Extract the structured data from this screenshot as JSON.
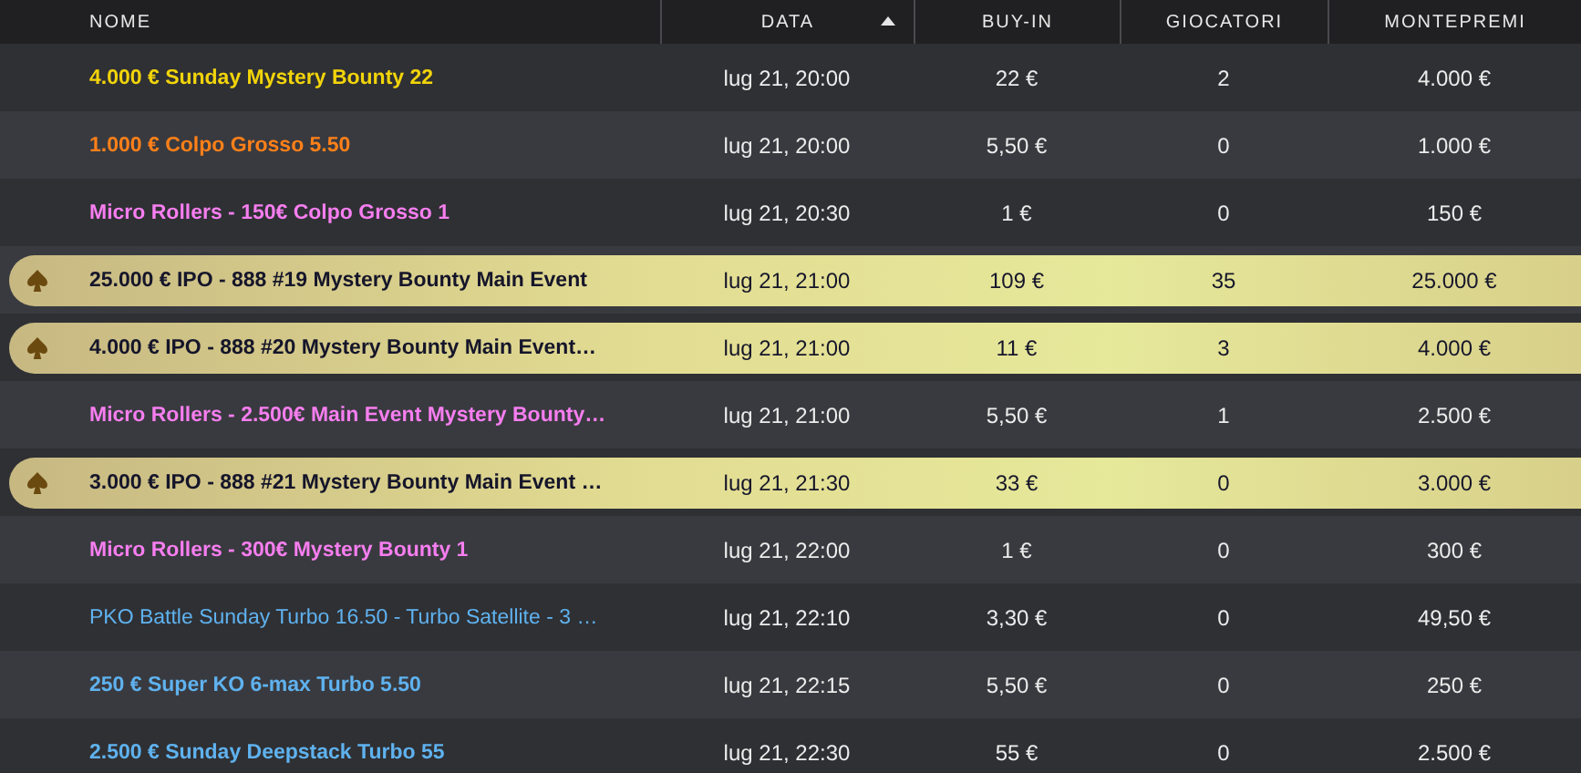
{
  "table": {
    "columns": [
      {
        "label": "NOME",
        "sorted": false
      },
      {
        "label": "DATA",
        "sorted": true
      },
      {
        "label": "BUY-IN",
        "sorted": false
      },
      {
        "label": "GIOCATORI",
        "sorted": false
      },
      {
        "label": "MONTEPREMI",
        "sorted": false
      }
    ],
    "rows": [
      {
        "kind": "normal",
        "name": "4.000 € Sunday Mystery Bounty 22",
        "color": "#f2d40a",
        "bold": true,
        "date": "lug 21, 20:00",
        "buy_in": "22 €",
        "players": "2",
        "prize": "4.000 €"
      },
      {
        "kind": "normal",
        "name": "1.000 € Colpo Grosso 5.50",
        "color": "#ff8019",
        "bold": true,
        "date": "lug 21, 20:00",
        "buy_in": "5,50 €",
        "players": "0",
        "prize": "1.000 €"
      },
      {
        "kind": "normal",
        "name": "Micro Rollers - 150€ Colpo Grosso 1",
        "color": "#f77ef0",
        "bold": true,
        "date": "lug 21, 20:30",
        "buy_in": "1 €",
        "players": "0",
        "prize": "150 €"
      },
      {
        "kind": "featured",
        "name": "25.000 € IPO - 888 #19 Mystery Bounty Main Event",
        "date": "lug 21, 21:00",
        "buy_in": "109 €",
        "players": "35",
        "prize": "25.000 €"
      },
      {
        "kind": "featured",
        "name": "4.000 € IPO - 888 #20 Mystery Bounty Main Event…",
        "date": "lug 21, 21:00",
        "buy_in": "11 €",
        "players": "3",
        "prize": "4.000 €"
      },
      {
        "kind": "normal",
        "name": "Micro Rollers - 2.500€ Main Event Mystery Bounty…",
        "color": "#f77ef0",
        "bold": true,
        "date": "lug 21, 21:00",
        "buy_in": "5,50 €",
        "players": "1",
        "prize": "2.500 €"
      },
      {
        "kind": "featured",
        "name": "3.000 € IPO - 888 #21 Mystery Bounty Main Event …",
        "date": "lug 21, 21:30",
        "buy_in": "33 €",
        "players": "0",
        "prize": "3.000 €"
      },
      {
        "kind": "normal",
        "name": "Micro Rollers - 300€ Mystery Bounty 1",
        "color": "#f77ef0",
        "bold": true,
        "date": "lug 21, 22:00",
        "buy_in": "1 €",
        "players": "0",
        "prize": "300 €"
      },
      {
        "kind": "normal",
        "name": "PKO Battle Sunday Turbo 16.50 - Turbo Satellite - 3 …",
        "color": "#5fb2ef",
        "bold": false,
        "date": "lug 21, 22:10",
        "buy_in": "3,30 €",
        "players": "0",
        "prize": "49,50 €"
      },
      {
        "kind": "normal",
        "name": "250 € Super KO 6-max Turbo 5.50",
        "color": "#5fb2ef",
        "bold": true,
        "date": "lug 21, 22:15",
        "buy_in": "5,50 €",
        "players": "0",
        "prize": "250 €"
      },
      {
        "kind": "normal",
        "name": "2.500 € Sunday Deepstack Turbo 55",
        "color": "#5fb2ef",
        "bold": true,
        "date": "lug 21, 22:30",
        "buy_in": "55 €",
        "players": "0",
        "prize": "2.500 €"
      }
    ]
  }
}
